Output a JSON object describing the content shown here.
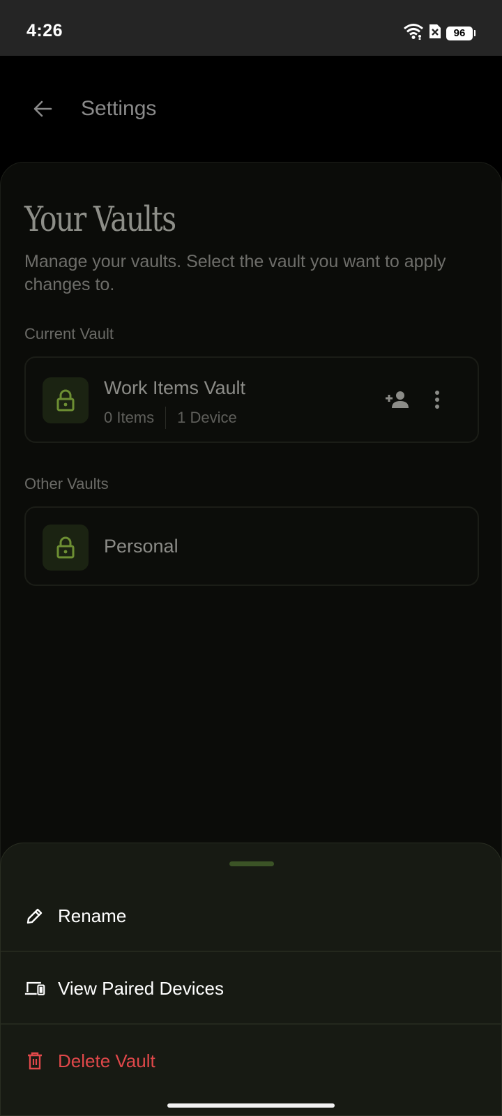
{
  "status_bar": {
    "time": "4:26",
    "battery": "96",
    "icons": [
      "wifi-icon",
      "sim-error-icon",
      "battery-icon"
    ]
  },
  "header": {
    "title": "Settings",
    "back_icon": "arrow-back-icon"
  },
  "vaults": {
    "heading": "Your Vaults",
    "description": "Manage your vaults. Select the vault you want to apply changes to.",
    "current_label": "Current Vault",
    "current": {
      "name": "Work Items Vault",
      "items": "0 Items",
      "devices": "1 Device",
      "icon": "lock-icon",
      "actions": [
        "add-person-icon",
        "more-vert-icon"
      ]
    },
    "other_label": "Other Vaults",
    "other": [
      {
        "name": "Personal",
        "icon": "lock-icon"
      }
    ]
  },
  "sheet": {
    "items": [
      {
        "label": "Rename",
        "icon": "pencil-icon",
        "color": "#ffffff"
      },
      {
        "label": "View Paired Devices",
        "icon": "devices-icon",
        "color": "#ffffff"
      },
      {
        "label": "Delete Vault",
        "icon": "trash-icon",
        "color": "#e0484a"
      }
    ]
  },
  "colors": {
    "accent": "#6d8f33",
    "danger": "#e0484a",
    "sheet_bg": "#171a13"
  }
}
